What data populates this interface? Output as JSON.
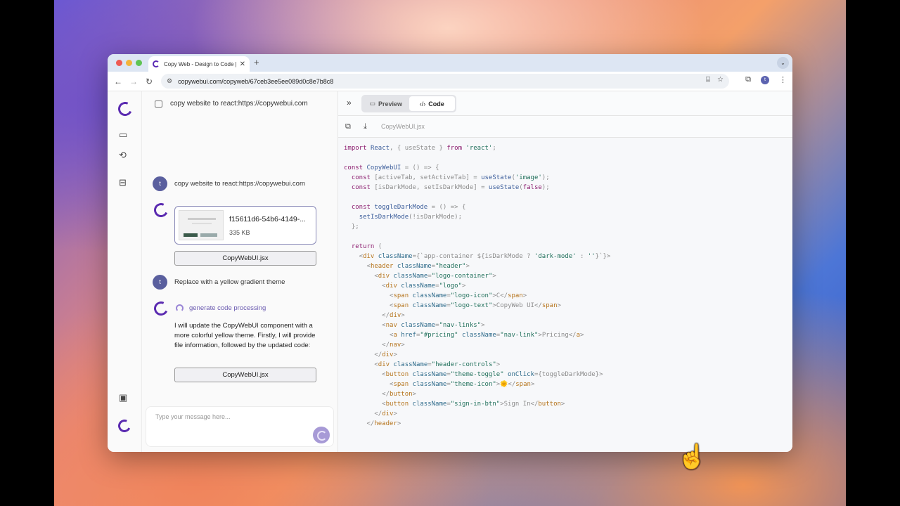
{
  "browser": {
    "tab_title": "Copy Web - Design to Code |",
    "tab_close": "✕",
    "new_tab": "+",
    "url": "copywebui.com/copyweb/67ceb3ee5ee089d0c8e7b8c8",
    "profile_initial": "t"
  },
  "chat": {
    "header_text": "copy website to react:https://copywebui.com",
    "messages": [
      {
        "role": "user",
        "initial": "t",
        "text": "copy website to react:https://copywebui.com"
      },
      {
        "role": "user",
        "initial": "t",
        "text": "Replace with a yellow gradient theme"
      }
    ],
    "file_card": {
      "name": "f15611d6-54b6-4149-...",
      "size": "335 KB"
    },
    "file_button_1": "CopyWebUI.jsx",
    "processing": "generate code processing",
    "bot_text": "I will update the CopyWebUI component with a more colorful yellow theme. Firstly, I will provide file information, followed by the updated code:",
    "file_button_2": "CopyWebUI.jsx",
    "composer_placeholder": "Type your message here..."
  },
  "code_panel": {
    "preview_label": "Preview",
    "code_label": "Code",
    "filename": "CopyWebUI.jsx"
  },
  "colors": {
    "brand": "#5a2ab0",
    "accent": "#a79ad6"
  }
}
